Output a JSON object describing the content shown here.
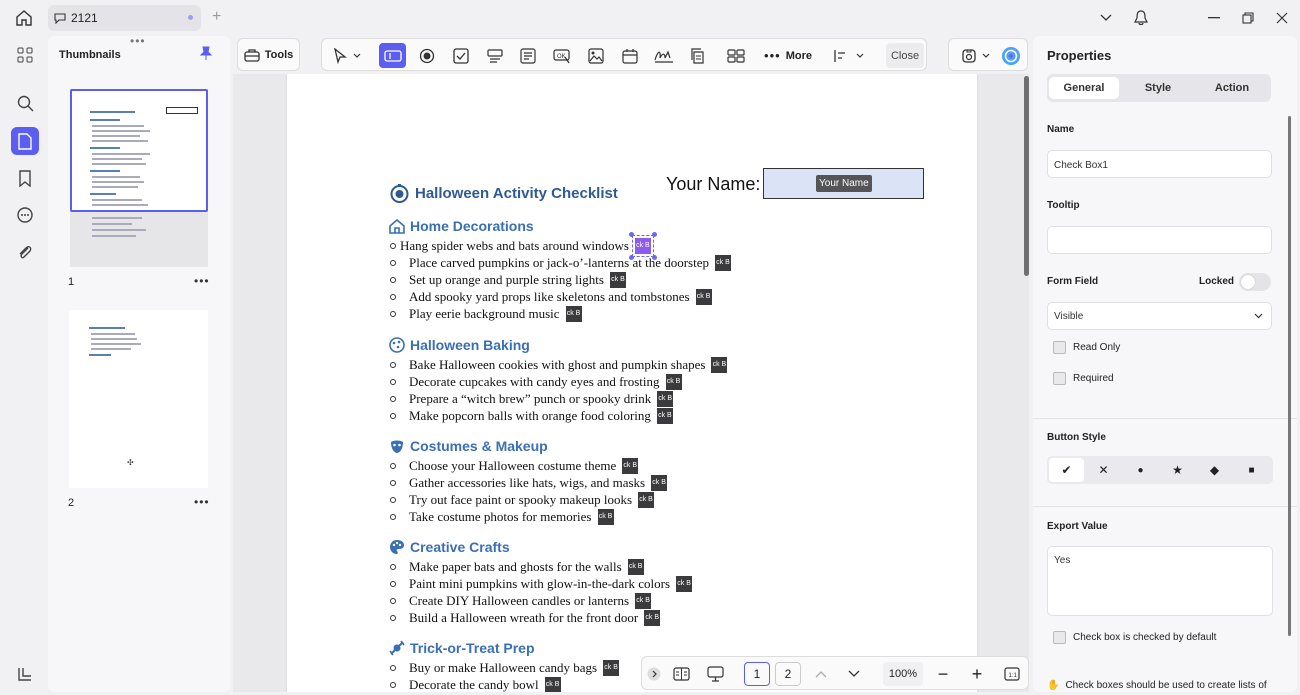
{
  "titlebar": {
    "tab_label": "2121"
  },
  "thumbnails": {
    "title": "Thumbnails",
    "grip": "•••",
    "pages": [
      {
        "num": "1",
        "more": "•••"
      },
      {
        "num": "2",
        "more": "•••"
      }
    ]
  },
  "toolbar": {
    "tools_label": "Tools",
    "more_label": "More",
    "close_label": "Close"
  },
  "document": {
    "title": "Halloween Activity Checklist",
    "name_label": "Your Name:",
    "name_field_tooltip": "Your Name",
    "checkbox_tag": "ck B",
    "sections": [
      {
        "title": "Home Decorations",
        "icon": "house-icon",
        "items": [
          "Hang spider webs and bats around windows",
          "Place carved pumpkins or jack-o’-lanterns at the doorstep",
          "Set up orange and purple string lights",
          "Add spooky yard props like skeletons and tombstones",
          "Play eerie background music"
        ]
      },
      {
        "title": "Halloween Baking",
        "icon": "cookie-icon",
        "items": [
          "Bake Halloween cookies with ghost and pumpkin shapes",
          "Decorate cupcakes with candy eyes and frosting",
          "Prepare a “witch brew” punch or spooky drink",
          "Make popcorn balls with orange food coloring"
        ]
      },
      {
        "title": "Costumes & Makeup",
        "icon": "mask-icon",
        "items": [
          "Choose your Halloween costume theme",
          "Gather accessories like hats, wigs, and masks",
          "Try out face paint or spooky makeup looks",
          "Take costume photos for memories"
        ]
      },
      {
        "title": "Creative Crafts",
        "icon": "palette-icon",
        "items": [
          "Make paper bats and ghosts for the walls",
          "Paint mini pumpkins with glow-in-the-dark colors",
          "Create DIY Halloween candles or lanterns",
          "Build a Halloween wreath for the front door"
        ]
      },
      {
        "title": "Trick-or-Treat Prep",
        "icon": "candy-icon",
        "items": [
          "Buy or make Halloween candy bags",
          "Decorate the candy bowl"
        ]
      }
    ]
  },
  "bottomnav": {
    "page1": "1",
    "page2": "2",
    "zoom": "100%"
  },
  "properties": {
    "title": "Properties",
    "tabs": [
      "General",
      "Style",
      "Action"
    ],
    "name_label": "Name",
    "name_value": "Check Box1",
    "tooltip_label": "Tooltip",
    "tooltip_value": "",
    "form_field_label": "Form Field",
    "locked_label": "Locked",
    "visibility_value": "Visible",
    "read_only_label": "Read Only",
    "required_label": "Required",
    "button_style_label": "Button Style",
    "button_styles": [
      "✔",
      "✕",
      "●",
      "★",
      "◆",
      "■"
    ],
    "export_value_label": "Export Value",
    "export_value": "Yes",
    "default_checked_label": "Check box is checked by default",
    "hint": "Check boxes should be used to create lists of"
  },
  "colors": {
    "accent": "#5b5ef0",
    "heading": "#3a6fb3",
    "title": "#2e5a93"
  }
}
